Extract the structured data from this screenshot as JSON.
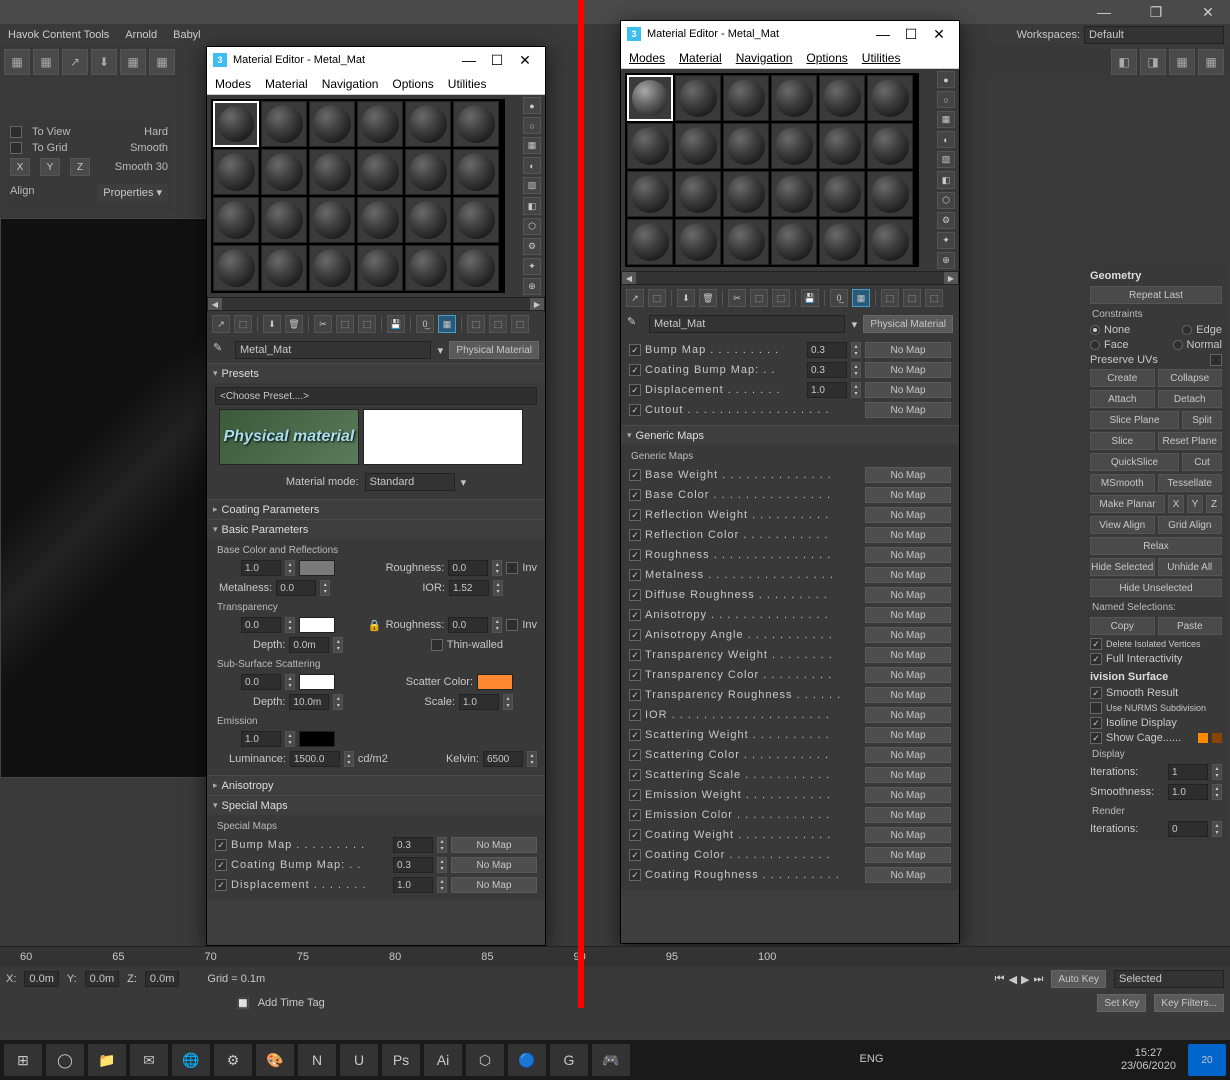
{
  "app": {
    "workspace_label": "Workspaces:",
    "workspace_value": "Default",
    "menubar_left": [
      "Havok Content Tools",
      "Arnold",
      "Babyl"
    ]
  },
  "topwin": {
    "min": "—",
    "max": "❐",
    "close": "✕"
  },
  "leftpanel": {
    "row1a": "To View",
    "row1b": "Hard",
    "row2a": "To Grid",
    "row2b": "Smooth",
    "row3b": "Smooth 30",
    "x": "X",
    "y": "Y",
    "z": "Z",
    "align": "Align",
    "props": "Properties ▾"
  },
  "matedit": {
    "title": "Material Editor - Metal_Mat",
    "menu": [
      "Modes",
      "Material",
      "Navigation",
      "Options",
      "Utilities"
    ],
    "name": "Metal_Mat",
    "type_btn": "Physical Material",
    "presets_head": "Presets",
    "preset_dd": "<Choose Preset....>",
    "preset_img": "Physical material",
    "matmode_lbl": "Material mode:",
    "matmode_val": "Standard",
    "coating_head": "Coating Parameters",
    "basic_head": "Basic Parameters",
    "basic_sub": "Base Color and Reflections",
    "roughness_lbl": "Roughness:",
    "metalness_lbl": "Metalness:",
    "ior_lbl": "IOR:",
    "inv": "Inv",
    "transp_head": "Transparency",
    "depth_lbl": "Depth:",
    "thin": "Thin-walled",
    "sss_head": "Sub-Surface Scattering",
    "scatter_lbl": "Scatter Color:",
    "scale_lbl": "Scale:",
    "emis_head": "Emission",
    "lum_lbl": "Luminance:",
    "lum_unit": "cd/m2",
    "kelvin_lbl": "Kelvin:",
    "aniso_head": "Anisotropy",
    "smaps_head": "Special Maps",
    "smaps_sub": "Special Maps",
    "nomap": "No Map",
    "vals": {
      "base_w": "1.0",
      "rough": "0.0",
      "metal": "0.0",
      "ior": "1.52",
      "trans": "0.0",
      "trough": "0.0",
      "tdepth": "0.0m",
      "sss": "0.0",
      "sdepth": "10.0m",
      "sscale": "1.0",
      "emis": "1.0",
      "lum": "1500.0",
      "kelvin": "6500"
    },
    "smaps": [
      {
        "label": "Bump Map . . . . . . . . .",
        "val": "0.3"
      },
      {
        "label": "Coating Bump Map: . .",
        "val": "0.3"
      },
      {
        "label": "Displacement . . . . . . .",
        "val": "1.0"
      }
    ]
  },
  "matedit_r": {
    "smaps": [
      {
        "label": "Bump Map . . . . . . . . .",
        "val": "0.3"
      },
      {
        "label": "Coating Bump Map: . .",
        "val": "0.3"
      },
      {
        "label": "Displacement . . . . . . .",
        "val": "1.0"
      },
      {
        "label": "Cutout . . . . . . . . . . . . . . . . . .",
        "val": ""
      }
    ],
    "gmaps_head": "Generic Maps",
    "gmaps_sub": "Generic Maps",
    "gmaps": [
      "Base Weight . . . . . . . . . . . . . .",
      "Base Color . . . . . . . . . . . . . . .",
      "Reflection Weight . . . . . . . . . .",
      "Reflection Color . . . . . . . . . . .",
      "Roughness . . . . . . . . . . . . . . .",
      "Metalness . . . . . . . . . . . . . . . .",
      "Diffuse Roughness  . . . . . . . . .",
      "Anisotropy . . . . . . . . . . . . . . .",
      "Anisotropy Angle . . . . . . . . . . .",
      "Transparency Weight . . . . . . . .",
      "Transparency Color . . . . . . . . .",
      "Transparency Roughness . . . . . .",
      "IOR . . . . . . . . . . . . . . . . . . . .",
      "Scattering Weight . . . . . . . . . .",
      "Scattering Color . . . . . . . . . . .",
      "Scattering Scale . . . . . . . . . . .",
      "Emission Weight . . . . . . . . . . .",
      "Emission Color . . . . . . . . . . . .",
      "Coating Weight . . . . . . . . . . . .",
      "Coating Color . . . . . . . . . . . . .",
      "Coating Roughness . . . . . . . . . ."
    ]
  },
  "rpanel": {
    "geometry": "Geometry",
    "repeat": "Repeat Last",
    "constraints": "Constraints",
    "none": "None",
    "edge": "Edge",
    "face": "Face",
    "normal": "Normal",
    "preserve": "Preserve UVs",
    "create": "Create",
    "collapse": "Collapse",
    "attach": "Attach",
    "detach": "Detach",
    "sliceplane": "Slice Plane",
    "split": "Split",
    "slice": "Slice",
    "reset": "Reset Plane",
    "quickslice": "QuickSlice",
    "cut": "Cut",
    "msmooth": "MSmooth",
    "tess": "Tessellate",
    "makeplanar": "Make Planar",
    "x": "X",
    "y": "Y",
    "z": "Z",
    "viewalign": "View Align",
    "gridalign": "Grid Align",
    "relax": "Relax",
    "hidesel": "Hide Selected",
    "unhide": "Unhide All",
    "hideun": "Hide Unselected",
    "namedsel": "Named Selections:",
    "copy": "Copy",
    "paste": "Paste",
    "delete": "Delete Isolated Vertices",
    "fullint": "Full Interactivity",
    "divsurf": "ivision Surface",
    "smoothres": "Smooth Result",
    "nurms": "Use NURMS Subdivision",
    "isoline": "Isoline Display",
    "showcage": "Show Cage......",
    "display": "Display",
    "iter": "Iterations:",
    "iter_v": "1",
    "smooth": "Smoothness:",
    "smooth_v": "1.0",
    "render": "Render",
    "riter": "Iterations:",
    "riter_v": "0"
  },
  "bottom": {
    "ticks": [
      "60",
      "65",
      "70",
      "75",
      "80",
      "85",
      "90",
      "95",
      "100"
    ],
    "x": "X:",
    "xv": "0.0m",
    "y": "Y:",
    "yv": "0.0m",
    "z": "Z:",
    "zv": "0.0m",
    "grid": "Grid = 0.1m",
    "addtime": "Add Time Tag",
    "autokey": "Auto Key",
    "setkey": "Set Key",
    "selected": "Selected",
    "keyfilters": "Key Filters...",
    "lang": "ENG",
    "time": "15:27",
    "date": "23/06/2020",
    "notif": "20"
  },
  "taskbar_icons": [
    "⊞",
    "◯",
    "📁",
    "✉",
    "🌐",
    "⚙",
    "🎨",
    "N",
    "U",
    "Ps",
    "Ai",
    "⬡",
    "🔵",
    "G",
    "🎮"
  ]
}
